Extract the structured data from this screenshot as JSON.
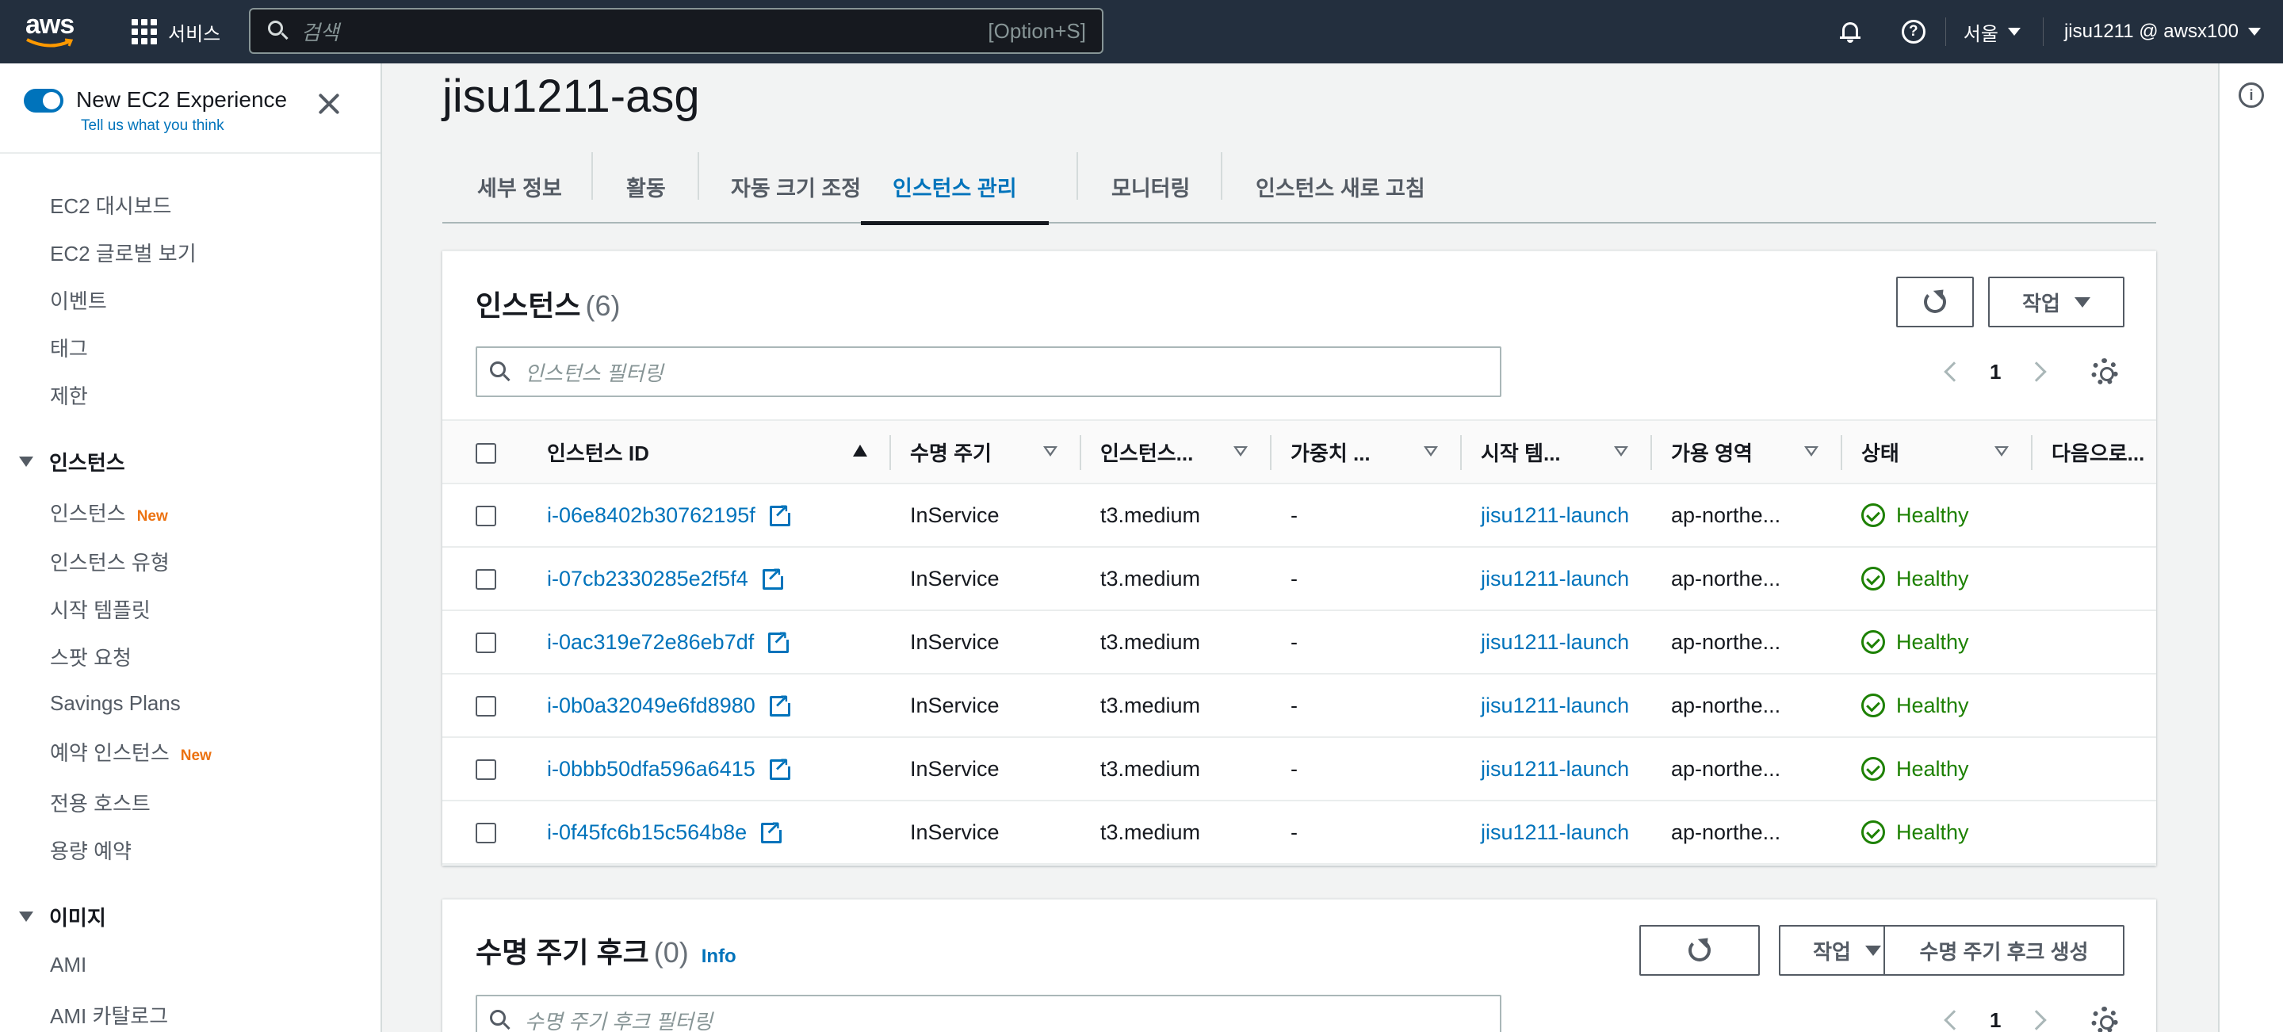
{
  "topnav": {
    "logo": "aws",
    "services_label": "서비스",
    "search_placeholder": "검색",
    "search_shortcut": "[Option+S]",
    "region": "서울",
    "account": "jisu1211 @ awsx100",
    "help_glyph": "?"
  },
  "sidebar": {
    "toggle_title": "New EC2 Experience",
    "toggle_link": "Tell us what you think",
    "items_top": [
      "EC2 대시보드",
      "EC2 글로벌 보기",
      "이벤트",
      "태그",
      "제한"
    ],
    "section_instances": "인스턴스",
    "instances_items": [
      {
        "label": "인스턴스",
        "badge": "New"
      },
      {
        "label": "인스턴스 유형",
        "badge": ""
      },
      {
        "label": "시작 템플릿",
        "badge": ""
      },
      {
        "label": "스팟 요청",
        "badge": ""
      },
      {
        "label": "Savings Plans",
        "badge": ""
      },
      {
        "label": "예약 인스턴스",
        "badge": "New"
      },
      {
        "label": "전용 호스트",
        "badge": ""
      },
      {
        "label": "용량 예약",
        "badge": ""
      }
    ],
    "section_images": "이미지",
    "images_items": [
      "AMI",
      "AMI 카탈로그"
    ]
  },
  "page": {
    "title": "jisu1211-asg",
    "tabs": [
      "세부 정보",
      "활동",
      "자동 크기 조정",
      "인스턴스 관리",
      "모니터링",
      "인스턴스 새로 고침"
    ],
    "active_tab": "인스턴스 관리"
  },
  "instances_panel": {
    "title": "인스턴스",
    "count": "(6)",
    "actions_label": "작업",
    "filter_placeholder": "인스턴스 필터링",
    "page_number": "1",
    "columns": [
      "인스턴스 ID",
      "수명 주기",
      "인스턴스...",
      "가중치 ...",
      "시작 템...",
      "가용 영역",
      "상태",
      "다음으로..."
    ],
    "rows": [
      {
        "id": "i-06e8402b30762195f",
        "lifecycle": "InService",
        "type": "t3.medium",
        "weight": "-",
        "template": "jisu1211-launch",
        "az": "ap-northe...",
        "status": "Healthy"
      },
      {
        "id": "i-07cb2330285e2f5f4",
        "lifecycle": "InService",
        "type": "t3.medium",
        "weight": "-",
        "template": "jisu1211-launch",
        "az": "ap-northe...",
        "status": "Healthy"
      },
      {
        "id": "i-0ac319e72e86eb7df",
        "lifecycle": "InService",
        "type": "t3.medium",
        "weight": "-",
        "template": "jisu1211-launch",
        "az": "ap-northe...",
        "status": "Healthy"
      },
      {
        "id": "i-0b0a32049e6fd8980",
        "lifecycle": "InService",
        "type": "t3.medium",
        "weight": "-",
        "template": "jisu1211-launch",
        "az": "ap-northe...",
        "status": "Healthy"
      },
      {
        "id": "i-0bbb50dfa596a6415",
        "lifecycle": "InService",
        "type": "t3.medium",
        "weight": "-",
        "template": "jisu1211-launch",
        "az": "ap-northe...",
        "status": "Healthy"
      },
      {
        "id": "i-0f45fc6b15c564b8e",
        "lifecycle": "InService",
        "type": "t3.medium",
        "weight": "-",
        "template": "jisu1211-launch",
        "az": "ap-northe...",
        "status": "Healthy"
      }
    ]
  },
  "hooks_panel": {
    "title": "수명 주기 후크",
    "count": "(0)",
    "info": "Info",
    "actions_label": "작업",
    "create_label": "수명 주기 후크 생성",
    "filter_placeholder": "수명 주기 후크 필터링",
    "page_number": "1"
  },
  "colors": {
    "nav_bg": "#232f3e",
    "accent": "#0073bb",
    "healthy": "#1d8102",
    "new_badge": "#ec7211"
  }
}
